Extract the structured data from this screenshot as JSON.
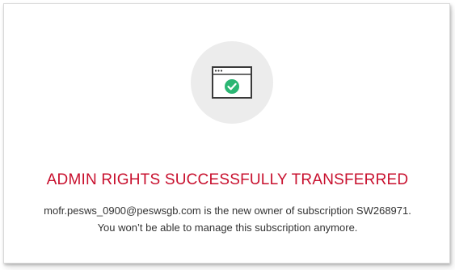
{
  "dialog": {
    "icon": "browser-window-checkmark-icon",
    "check_color": "#2bb673",
    "title": "ADMIN RIGHTS SUCCESSFULLY TRANSFERRED",
    "title_color": "#c8102e",
    "message_line1": "mofr.pesws_0900@peswsgb.com is the new owner of subscription SW268971.",
    "message_line2": "You won’t be able to manage this subscription anymore."
  }
}
